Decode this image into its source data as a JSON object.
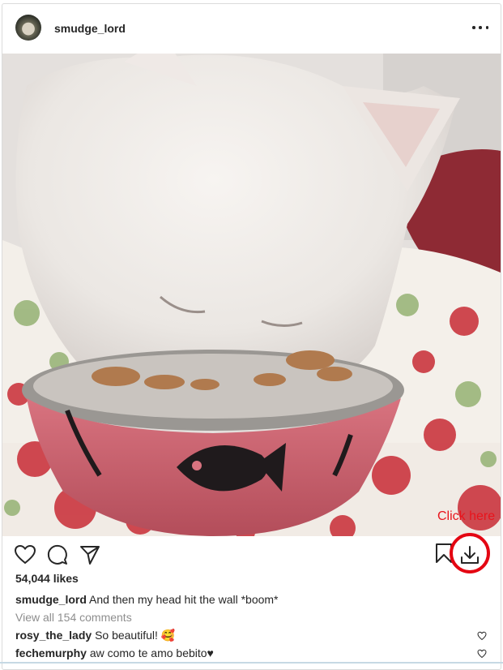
{
  "post": {
    "username": "smudge_lord",
    "likes": "54,044 likes",
    "caption_user": "smudge_lord",
    "caption_text": "And then my head hit the wall *boom*",
    "view_all": "View all 154 comments",
    "comments": [
      {
        "user": "rosy_the_lady",
        "text": "So beautiful! 🥰"
      },
      {
        "user": "fechemurphy",
        "text": "aw como te amo bebito♥"
      }
    ]
  },
  "annotation": {
    "label": "Click here",
    "color": "#e40612"
  },
  "icons": {
    "more": "more-options-icon",
    "like": "heart-icon",
    "comment": "comment-bubble-icon",
    "share": "paper-plane-icon",
    "save": "bookmark-icon",
    "download": "download-icon"
  }
}
